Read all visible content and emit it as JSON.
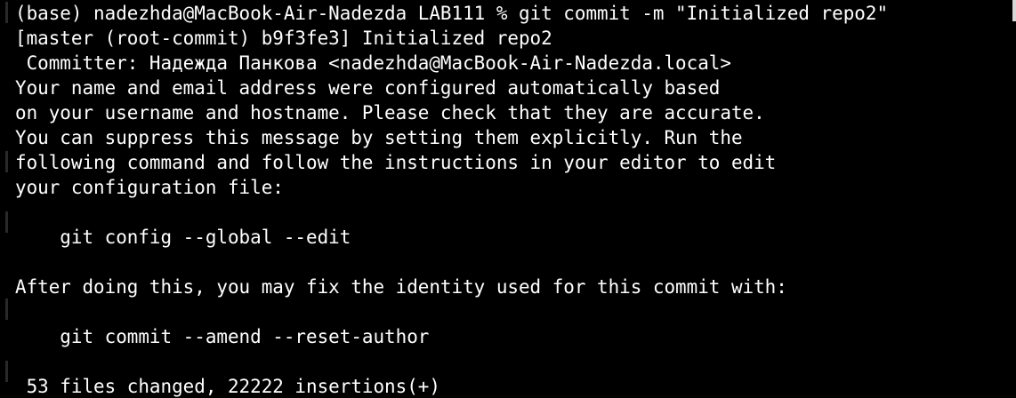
{
  "terminal": {
    "lines": [
      "(base) nadezhda@MacBook-Air-Nadezda LAB111 % git commit -m \"Initialized repo2\"",
      "[master (root-commit) b9f3fe3] Initialized repo2",
      " Committer: Надежда Панкова <nadezhda@MacBook-Air-Nadezda.local>",
      "Your name and email address were configured automatically based",
      "on your username and hostname. Please check that they are accurate.",
      "You can suppress this message by setting them explicitly. Run the",
      "following command and follow the instructions in your editor to edit",
      "your configuration file:",
      "",
      "    git config --global --edit",
      "",
      "After doing this, you may fix the identity used for this commit with:",
      "",
      "    git commit --amend --reset-author",
      "",
      " 53 files changed, 22222 insertions(+)"
    ]
  }
}
